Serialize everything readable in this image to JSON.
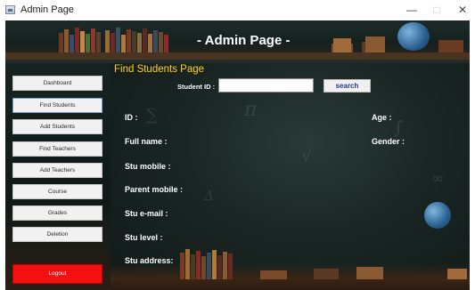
{
  "window": {
    "title": "Admin Page"
  },
  "header": {
    "title": "- Admin Page -"
  },
  "sidebar": {
    "items": [
      {
        "label": "Dashboard"
      },
      {
        "label": "Find Students"
      },
      {
        "label": "Add Students"
      },
      {
        "label": "Find Teachers"
      },
      {
        "label": "Add Teachers"
      },
      {
        "label": "Course"
      },
      {
        "label": "Grades"
      },
      {
        "label": "Deletion"
      }
    ],
    "logout_label": "Logout"
  },
  "main": {
    "heading": "Find Students Page",
    "search": {
      "label": "Student ID :",
      "value": "",
      "button_label": "search"
    },
    "fields": {
      "id": "ID :",
      "age": "Age :",
      "full_name": "Full name :",
      "gender": "Gender :",
      "stu_mobile": "Stu mobile :",
      "parent_mobile": "Parent mobile :",
      "stu_email": "Stu e-mail :",
      "stu_level": "Stu level :",
      "stu_address": "Stu address:"
    }
  },
  "colors": {
    "heading": "#ffd11a",
    "logout": "#f21010",
    "background": "#0d1614"
  }
}
